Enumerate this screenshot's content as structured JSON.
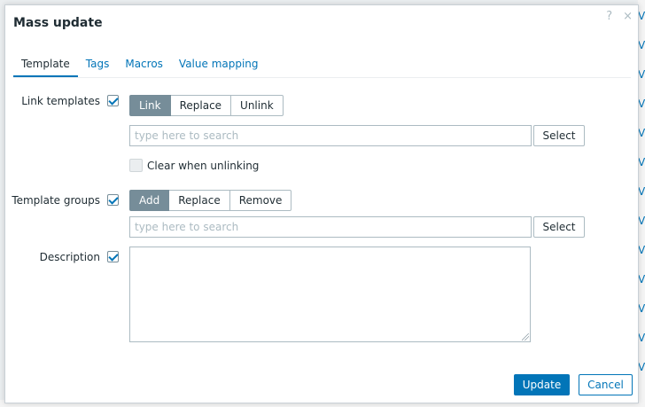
{
  "dialog": {
    "title": "Mass update",
    "help_glyph": "?",
    "close_glyph": "×"
  },
  "tabs": [
    {
      "label": "Template",
      "active": true
    },
    {
      "label": "Tags",
      "active": false
    },
    {
      "label": "Macros",
      "active": false
    },
    {
      "label": "Value mapping",
      "active": false
    }
  ],
  "link_templates": {
    "label": "Link templates",
    "checked": true,
    "modes": [
      "Link",
      "Replace",
      "Unlink"
    ],
    "selected_mode": "Link",
    "search_placeholder": "type here to search",
    "select_label": "Select",
    "clear_label": "Clear when unlinking",
    "clear_checked": false
  },
  "template_groups": {
    "label": "Template groups",
    "checked": true,
    "modes": [
      "Add",
      "Replace",
      "Remove"
    ],
    "selected_mode": "Add",
    "search_placeholder": "type here to search",
    "select_label": "Select"
  },
  "description": {
    "label": "Description",
    "checked": true,
    "value": ""
  },
  "footer": {
    "update_label": "Update",
    "cancel_label": "Cancel"
  },
  "colors": {
    "accent": "#0275b8",
    "segment_selected": "#768d99"
  }
}
